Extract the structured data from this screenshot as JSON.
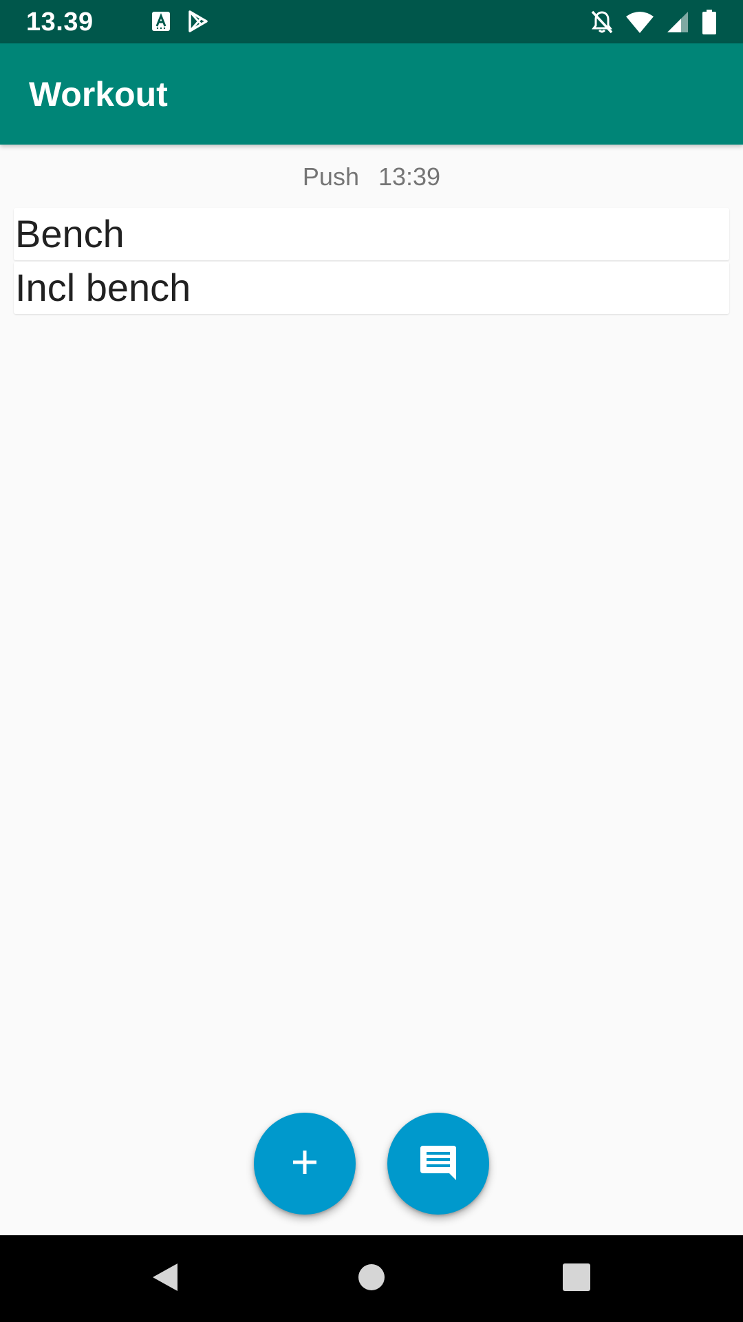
{
  "status_bar": {
    "time": "13.39",
    "left_icons": [
      "keyboard-a-icon",
      "play-store-icon"
    ],
    "right_icons": [
      "notifications-off-icon",
      "wifi-icon",
      "signal-icon",
      "battery-icon"
    ]
  },
  "app_bar": {
    "title": "Workout"
  },
  "session": {
    "name": "Push",
    "time": "13:39"
  },
  "exercises": [
    {
      "name": "Bench"
    },
    {
      "name": "Incl bench"
    }
  ],
  "fabs": {
    "add_icon": "plus-icon",
    "comment_icon": "comment-icon"
  },
  "nav_bar": {
    "icons": [
      "back-icon",
      "home-icon",
      "recents-icon"
    ]
  },
  "colors": {
    "status_bar": "#00574b",
    "app_bar": "#008577",
    "fab": "#0099cc",
    "background": "#fafafa"
  }
}
